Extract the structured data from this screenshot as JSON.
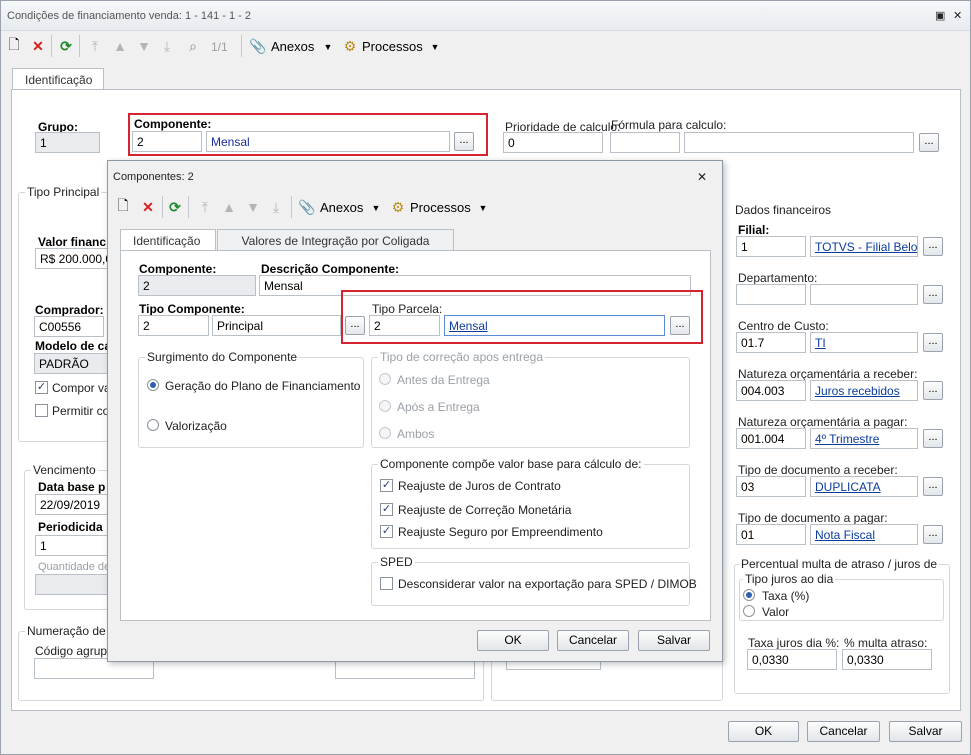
{
  "main": {
    "title": "Condições de financiamento venda: 1 - 141 - 1 - 2",
    "toolbar": {
      "record_counter": "1/1",
      "anexos": "Anexos",
      "processos": "Processos"
    },
    "tab_identificacao": "Identificação",
    "grupo_label": "Grupo:",
    "grupo_value": "1",
    "componente_label": "Componente:",
    "componente_code": "2",
    "componente_desc": "Mensal",
    "prioridade_label": "Prioridade de calculo:",
    "prioridade_value": "0",
    "formula_label": "Fórmula para calculo:",
    "tipo_principal": "Tipo Principal",
    "valor_financ_label": "Valor financ",
    "valor_financ_value": "R$ 200.000,0(",
    "comprador_label": "Comprador:",
    "comprador_value": "C00556",
    "modelo_label": "Modelo de ca",
    "modelo_value": "PADRÃO",
    "compor_label": "Compor val",
    "permitir_label": "Permitir cor",
    "vencimento": "Vencimento",
    "data_base_label": "Data base p",
    "data_base_value": "22/09/2019",
    "periodicidade_label": "Periodicida",
    "periodicidade_value": "1",
    "quantidade_label": "Quantidade de",
    "numeracao": "Numeração de n",
    "codigo_label": "Código agrupad",
    "dados_financeiros": "Dados financeiros",
    "filial_label": "Filial:",
    "filial_code": "1",
    "filial_name": "TOTVS - Filial Belo Ho",
    "departamento_label": "Departamento:",
    "centro_custo_label": "Centro de Custo:",
    "centro_custo_code": "01.7",
    "centro_custo_name": "TI",
    "nat_receber_label": "Natureza orçamentária a receber:",
    "nat_receber_code": "004.003",
    "nat_receber_name": "Juros recebidos",
    "nat_pagar_label": "Natureza orçamentária a pagar:",
    "nat_pagar_code": "001.004",
    "nat_pagar_name": "4º Trimestre",
    "doc_receber_label": "Tipo de documento a receber:",
    "doc_receber_code": "03",
    "doc_receber_name": "DUPLICATA",
    "doc_pagar_label": "Tipo de documento a pagar:",
    "doc_pagar_code": "01",
    "doc_pagar_name": "Nota Fiscal",
    "percentual_label": "Percentual multa de atraso / juros de",
    "tipo_juros_label": "Tipo juros ao dia",
    "taxa_option": "Taxa (%)",
    "valor_option": "Valor",
    "taxa_juros_label": "Taxa juros dia %:",
    "taxa_juros_value": "0,0330",
    "multa_label": "% multa atraso:",
    "multa_value": "0,0330",
    "ok": "OK",
    "cancel": "Cancelar",
    "save": "Salvar"
  },
  "dialog": {
    "title": "Componentes: 2",
    "toolbar": {
      "anexos": "Anexos",
      "processos": "Processos"
    },
    "tab1": "Identificação",
    "tab2": "Valores de Integração por Coligada",
    "componente_label": "Componente:",
    "componente_value": "2",
    "descricao_label": "Descrição Componente:",
    "descricao_value": "Mensal",
    "tipo_comp_label": "Tipo Componente:",
    "tipo_comp_code": "2",
    "tipo_comp_name": "Principal",
    "tipo_parcela_label": "Tipo Parcela:",
    "tipo_parcela_code": "2",
    "tipo_parcela_name": "Mensal",
    "surgimento_title": "Surgimento do Componente",
    "surgimento_opt1": "Geração do Plano de Financiamento",
    "surgimento_opt2": "Valorização",
    "correcao_title": "Tipo de correção apos entrega",
    "correcao_opt1": "Antes da Entrega",
    "correcao_opt2": "Após a Entrega",
    "correcao_opt3": "Ambos",
    "base_title": "Componente compõe valor base para cálculo de:",
    "base_opt1": "Reajuste de Juros de Contrato",
    "base_opt2": "Reajuste de Correção Monetária",
    "base_opt3": "Reajuste Seguro por Empreendimento",
    "sped_title": "SPED",
    "sped_opt": "Desconsiderar valor na exportação para SPED / DIMOB",
    "ok": "OK",
    "cancel": "Cancelar",
    "save": "Salvar"
  },
  "colors": {
    "highlight_border": "#d5242f",
    "link": "#0b3c9c",
    "radio_accent": "#2f5fb3"
  }
}
